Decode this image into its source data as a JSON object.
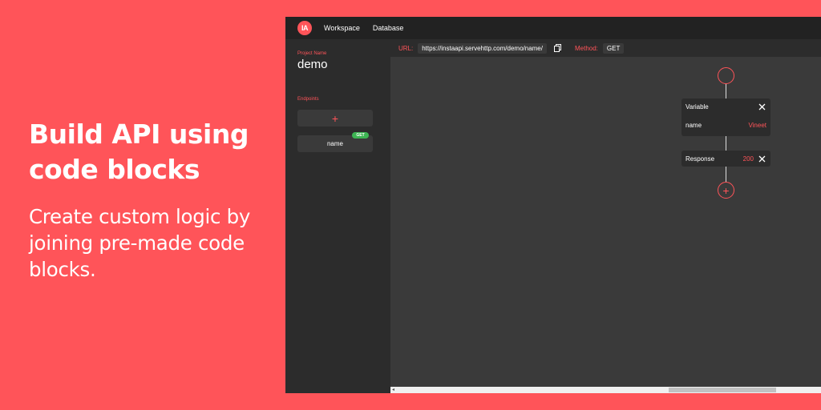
{
  "hero": {
    "title": "Build API using code blocks",
    "subtitle": "Create custom logic by joining pre-made code blocks."
  },
  "app": {
    "logo_text": "IA",
    "nav": [
      "Workspace",
      "Database"
    ],
    "sidebar": {
      "project_label": "Project Name",
      "project_name": "demo",
      "endpoints_label": "Endpoints",
      "add_symbol": "+",
      "endpoints": [
        {
          "name": "name",
          "method": "GET"
        }
      ]
    },
    "urlbar": {
      "url_label": "URL:",
      "url_value": "https://instaapi.servehttp.com/demo/name/",
      "method_label": "Method:",
      "method_value": "GET"
    },
    "flow": {
      "variable_block": {
        "title": "Variable",
        "key": "name",
        "value": "Vineet"
      },
      "response_block": {
        "title": "Response",
        "value": "200"
      },
      "add_symbol": "+"
    }
  },
  "colors": {
    "accent": "#ff5459",
    "badge_green": "#3db553",
    "dark": "#222222",
    "panel": "#2c2c2c",
    "canvas": "#3a3a3a"
  },
  "icons": [
    "copy-icon",
    "close-icon",
    "plus-icon",
    "scroll-left-arrow-icon"
  ]
}
